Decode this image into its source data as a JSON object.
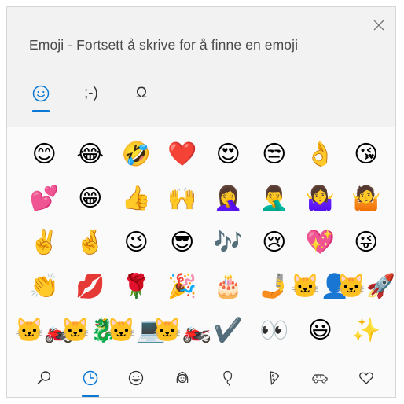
{
  "panel": {
    "title": "Emoji - Fortsett å skrive for å finne en emoji"
  },
  "tabs": [
    {
      "id": "emoji",
      "icon": "smiley-icon",
      "label": "",
      "active": true
    },
    {
      "id": "kaomoji",
      "icon": "",
      "label": ";-)",
      "active": false
    },
    {
      "id": "symbols",
      "icon": "",
      "label": "Ω",
      "active": false
    }
  ],
  "emojis": [
    "😊",
    "😂",
    "🤣",
    "❤️",
    "😍",
    "😒",
    "👌",
    "😘",
    "💕",
    "😁",
    "👍",
    "🙌",
    "🤦‍♀️",
    "🤦‍♂️",
    "🤷‍♀️",
    "🤷",
    "✌️",
    "🤞",
    "😉",
    "😎",
    "🎶",
    "😢",
    "💖",
    "😜",
    "👏",
    "💋",
    "🌹",
    "🎉",
    "🎂",
    "🤳",
    "🐱‍👤",
    "🐱‍🚀",
    "🐱‍🏍",
    "🐱‍🐉",
    "🐱‍💻",
    "🐱‍🏍",
    "✔️",
    "👀",
    "😃",
    "✨"
  ],
  "categories": [
    {
      "id": "search",
      "icon": "search-icon",
      "active": false
    },
    {
      "id": "recent",
      "icon": "clock-icon",
      "active": true
    },
    {
      "id": "smileys",
      "icon": "smiley-outline-icon",
      "active": false
    },
    {
      "id": "people",
      "icon": "person-icon",
      "active": false
    },
    {
      "id": "celebration",
      "icon": "balloon-icon",
      "active": false
    },
    {
      "id": "food",
      "icon": "pizza-icon",
      "active": false
    },
    {
      "id": "travel",
      "icon": "car-icon",
      "active": false
    },
    {
      "id": "symbols",
      "icon": "heart-outline-icon",
      "active": false
    }
  ],
  "colors": {
    "accent": "#0a78d4",
    "icon": "#333333"
  }
}
